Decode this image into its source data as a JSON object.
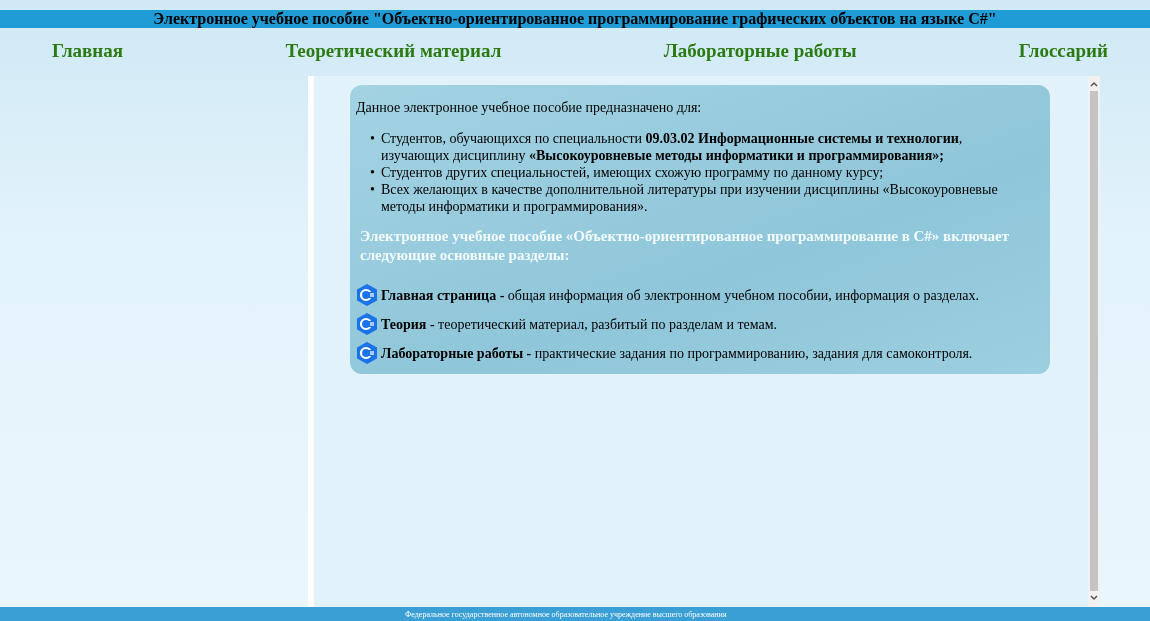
{
  "header": {
    "title": "Электронное учебное пособие \"Объектно-ориентированное программирование графических объектов на языке C#\""
  },
  "nav": [
    {
      "label": "Главная"
    },
    {
      "label": "Теоретический материал"
    },
    {
      "label": "Лабораторные работы"
    },
    {
      "label": "Глоссарий"
    }
  ],
  "content": {
    "intro": "Данное электронное учебное пособие предназначено для:",
    "audience": [
      {
        "marker": "•",
        "text": "Студентов, обучающихся по специальности **09.03.02 Информационные системы и технологии**, изучающих дисциплину **«Высокоуровневые методы информатики и программирования»;**"
      },
      {
        "marker": "•",
        "text": "Студентов других специальностей, имеющих схожую программу по данному курсу;"
      },
      {
        "marker": "•",
        "text": "Всех желающих в качестве дополнительной литературы при изучении дисциплины «Высокоуровневые методы информатики и программирования»."
      }
    ],
    "sections_heading": "Электронное учебное пособие «Объектно-ориентированное программирование в C#» включает следующие основные разделы:",
    "sections": [
      {
        "title": "Главная страница -",
        "text": "общая информация об электронном учебном пособии, информация о разделах."
      },
      {
        "title": "Теория -",
        "text": "теоретический материал, разбитый по разделам и темам."
      },
      {
        "title": "Лабораторные работы -",
        "text": "практические задания по программированию, задания для самоконтроля."
      }
    ]
  },
  "footer": {
    "text": "Федеральное государственное автономное образовательное учреждение высшего образования"
  }
}
